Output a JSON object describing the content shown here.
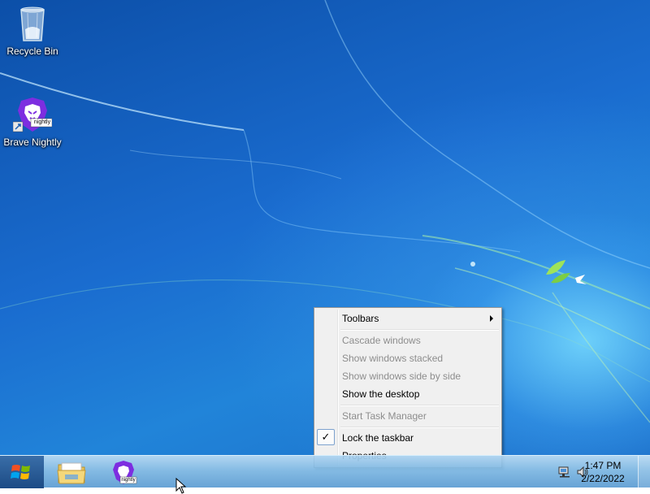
{
  "desktop": {
    "icons": [
      {
        "label": "Recycle Bin",
        "icon": "recycle-bin-icon"
      },
      {
        "label": "Brave Nightly",
        "icon": "brave-nightly-icon",
        "badge": "nightly"
      }
    ]
  },
  "context_menu": {
    "items": [
      {
        "label": "Toolbars",
        "enabled": true,
        "submenu": true
      },
      {
        "label": "Cascade windows",
        "enabled": false
      },
      {
        "label": "Show windows stacked",
        "enabled": false
      },
      {
        "label": "Show windows side by side",
        "enabled": false
      },
      {
        "label": "Show the desktop",
        "enabled": true
      },
      {
        "label": "Start Task Manager",
        "enabled": false
      },
      {
        "label": "Lock the taskbar",
        "enabled": true,
        "checked": true
      },
      {
        "label": "Properties",
        "enabled": true
      }
    ],
    "check_glyph": "✓"
  },
  "taskbar": {
    "pinned": [
      {
        "name": "windows-explorer",
        "icon": "folder-icon"
      },
      {
        "name": "brave-nightly",
        "icon": "brave-nightly-icon",
        "badge": "nightly"
      }
    ],
    "tray": {
      "icons": [
        "network-icon",
        "volume-icon"
      ],
      "time": "1:47 PM",
      "date": "2/22/2022"
    }
  },
  "colors": {
    "desktop_blue": "#1a6ccf",
    "brave_purple": "#7d2ee0",
    "menu_bg": "#f0f0f0",
    "disabled_text": "#8d8d8d"
  }
}
